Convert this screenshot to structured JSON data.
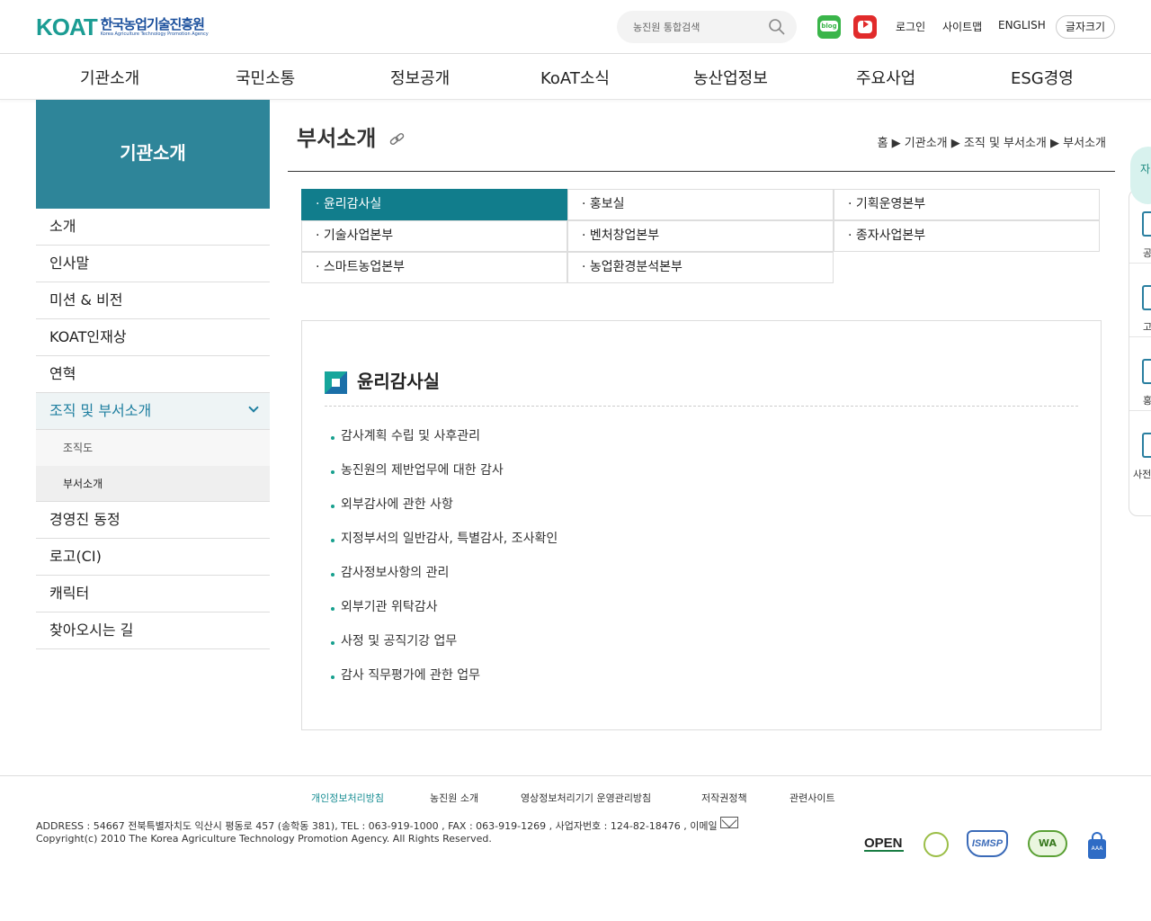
{
  "header": {
    "logo_mark": "KOAT",
    "logo_kr": "한국농업기술진흥원",
    "logo_en": "Korea Agriculture Technology Promotion Agency",
    "search_placeholder": "농진원 통합검색",
    "blog_label": "blog",
    "login": "로그인",
    "sitemap": "사이트맵",
    "english": "ENGLISH",
    "font_size": "글자크기"
  },
  "gnb": [
    "기관소개",
    "국민소통",
    "정보공개",
    "KoAT소식",
    "농산업정보",
    "주요사업",
    "ESG경영"
  ],
  "lnb": {
    "title": "기관소개",
    "items": [
      "소개",
      "인사말",
      "미션 & 비전",
      "KOAT인재상",
      "연혁"
    ],
    "active": "조직 및 부서소개",
    "subs": [
      "조직도",
      "부서소개"
    ],
    "items_after": [
      "경영진 동정",
      "로고(CI)",
      "캐릭터",
      "찾아오시는 길"
    ]
  },
  "page": {
    "title": "부서소개",
    "breadcrumb": "홈 ▶ 기관소개 ▶ 조직 및 부서소개 ▶ 부서소개"
  },
  "tabs": [
    "· 윤리감사실",
    "· 홍보실",
    "· 기획운영본부",
    "· 기술사업본부",
    "· 벤처창업본부",
    "· 종자사업본부",
    "· 스마트농업본부",
    "· 농업환경분석본부"
  ],
  "panel": {
    "title": "윤리감사실",
    "duties": [
      "감사계획 수립 및 사후관리",
      "농진원의 제반업무에 대한 감사",
      "외부감사에 관한 사항",
      "지정부서의 일반감사, 특별감사, 조사확인",
      "감사정보사항의 관리",
      "외부기관 위탁감사",
      "사정 및 공직기강 업무",
      "감사 직무평가에 관한 업무"
    ]
  },
  "quick": {
    "top": "자",
    "items": [
      "공",
      "고",
      "홍",
      "사전"
    ]
  },
  "footer": {
    "links": [
      "개인정보처리방침",
      "농진원 소개",
      "영상정보처리기기 운영관리방침",
      "저작권정책",
      "관련사이트"
    ],
    "address": "ADDRESS : 54667 전북특별자치도 익산시 평동로 457 (송학동 381), TEL : 063-919-1000 , FAX : 063-919-1269 , 사업자번호 : 124-82-18476 ,  이메일",
    "copyright": "Copyright(c) 2010 The Korea Agriculture Technology Promotion Agency. All Rights Reserved.",
    "badge_open": "OPEN",
    "badge_ismsp": "ISMSP",
    "badge_wa": "WA",
    "badge_lock": "AAA"
  }
}
